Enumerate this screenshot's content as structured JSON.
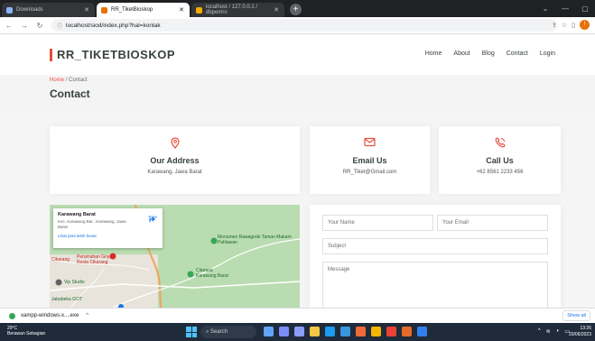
{
  "browser": {
    "tabs": [
      {
        "label": "Downloads",
        "active": false,
        "favicon_color": "#8ab4f8"
      },
      {
        "label": "RR_TiketBioskop",
        "active": true,
        "favicon_color": "#e8710a"
      },
      {
        "label": "localhost / 127.0.0.1 / dbpemro",
        "active": false,
        "favicon_color": "#f9ab00"
      }
    ],
    "new_tab": "+",
    "url": "localhost/siod/index.php?hal=kontak",
    "window_controls": [
      "⌄",
      "—",
      "▢"
    ],
    "profile_initial": "!"
  },
  "site": {
    "logo": "RR_TIKETBIOSKOP",
    "accent": "#e74c3c",
    "nav": [
      "Home",
      "About",
      "Blog",
      "Contact",
      "Login"
    ]
  },
  "breadcrumb": {
    "home": "Home",
    "separator": "/",
    "current": "Contact"
  },
  "page_title": "Contact",
  "info": {
    "address": {
      "icon": "map-pin-icon",
      "title": "Our Address",
      "text": "Karawang, Jawa Barat"
    },
    "email": {
      "icon": "envelope-icon",
      "title": "Email Us",
      "text": "RR_Tiket@Gmail.com"
    },
    "call": {
      "icon": "phone-icon",
      "title": "Call Us",
      "text": "+62 8561 2233 456"
    }
  },
  "map": {
    "place": "Karawang Barat",
    "address": "Kec. Karawang Bar., Karawang, Jawa Barat",
    "link": "Lihat peta lebih besar",
    "route": "Rute",
    "labels": [
      "Monumen Rawagede Taman Makam Pahlawan",
      "Cikarang",
      "Perumahan Griya Resta Cikarang",
      "Citarasa Karawang Barat",
      "Vip Studio",
      "Jababeka GOT"
    ]
  },
  "form": {
    "name_placeholder": "Your Name",
    "email_placeholder": "Your Email",
    "subject_placeholder": "Subject",
    "message_placeholder": "Message"
  },
  "downloads": {
    "file": "xampp-windows-x....exe",
    "chevron": "^",
    "show_all": "Show all"
  },
  "taskbar": {
    "weather_temp": "29°C",
    "weather_desc": "Berawan Sebagian",
    "search": "Search",
    "time": "13:26",
    "date": "20/06/2023"
  }
}
